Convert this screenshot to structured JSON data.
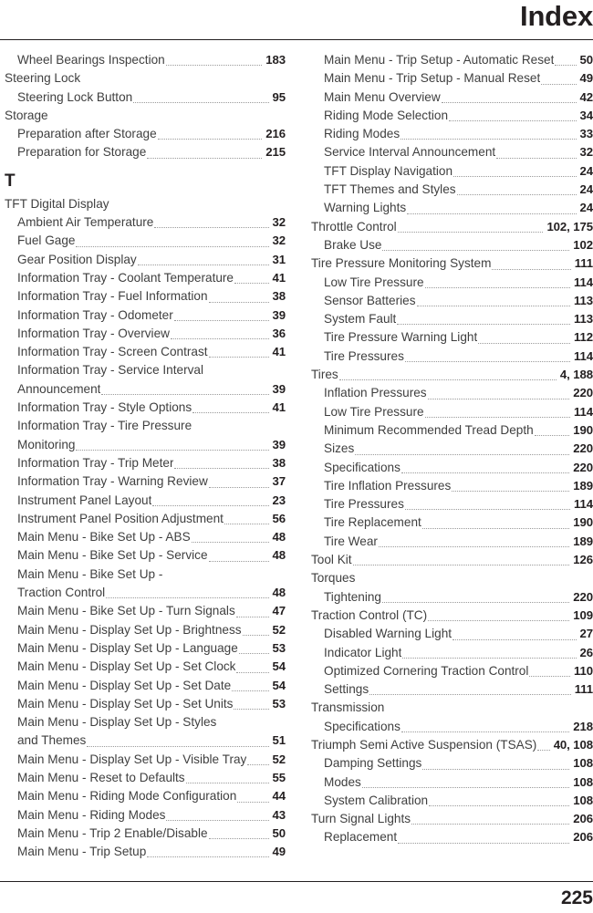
{
  "header": {
    "title": "Index"
  },
  "footer": {
    "page_number": "225"
  },
  "columns": {
    "left": [
      {
        "type": "entry",
        "level": 1,
        "label": "Wheel Bearings Inspection",
        "page": "183"
      },
      {
        "type": "entry",
        "level": 0,
        "label": "Steering Lock",
        "page": ""
      },
      {
        "type": "entry",
        "level": 1,
        "label": "Steering Lock Button",
        "page": "95"
      },
      {
        "type": "entry",
        "level": 0,
        "label": "Storage",
        "page": ""
      },
      {
        "type": "entry",
        "level": 1,
        "label": "Preparation after Storage",
        "page": "216"
      },
      {
        "type": "entry",
        "level": 1,
        "label": "Preparation for Storage",
        "page": "215"
      },
      {
        "type": "letter",
        "label": "T"
      },
      {
        "type": "entry",
        "level": 0,
        "label": "TFT Digital Display",
        "page": ""
      },
      {
        "type": "entry",
        "level": 1,
        "label": "Ambient Air Temperature",
        "page": "32"
      },
      {
        "type": "entry",
        "level": 1,
        "label": "Fuel Gage",
        "page": "32"
      },
      {
        "type": "entry",
        "level": 1,
        "label": "Gear Position Display",
        "page": "31"
      },
      {
        "type": "entry",
        "level": 1,
        "label": "Information Tray - Coolant Temperature",
        "page": "41"
      },
      {
        "type": "entry",
        "level": 1,
        "label": "Information Tray - Fuel Information",
        "page": "38"
      },
      {
        "type": "entry",
        "level": 1,
        "label": "Information Tray - Odometer",
        "page": "39"
      },
      {
        "type": "entry",
        "level": 1,
        "label": "Information Tray - Overview",
        "page": "36"
      },
      {
        "type": "entry",
        "level": 1,
        "label": "Information Tray - Screen Contrast",
        "page": "41"
      },
      {
        "type": "wrap",
        "level": 1,
        "line1": "Information Tray - Service Interval",
        "line2": "Announcement",
        "page": "39"
      },
      {
        "type": "entry",
        "level": 1,
        "label": "Information Tray - Style Options",
        "page": "41"
      },
      {
        "type": "wrap",
        "level": 1,
        "line1": "Information Tray - Tire Pressure",
        "line2": "Monitoring",
        "page": "39"
      },
      {
        "type": "entry",
        "level": 1,
        "label": "Information Tray - Trip Meter",
        "page": "38"
      },
      {
        "type": "entry",
        "level": 1,
        "label": "Information Tray - Warning Review",
        "page": "37"
      },
      {
        "type": "entry",
        "level": 1,
        "label": "Instrument Panel Layout",
        "page": "23"
      },
      {
        "type": "entry",
        "level": 1,
        "label": "Instrument Panel Position Adjustment",
        "page": "56"
      },
      {
        "type": "entry",
        "level": 1,
        "label": "Main Menu - Bike Set Up - ABS",
        "page": "48"
      },
      {
        "type": "entry",
        "level": 1,
        "label": "Main Menu - Bike Set Up - Service",
        "page": "48"
      },
      {
        "type": "wrap",
        "level": 1,
        "line1": "Main Menu - Bike Set Up -",
        "line2": "Traction Control",
        "page": "48"
      },
      {
        "type": "entry",
        "level": 1,
        "label": "Main Menu - Bike Set Up - Turn Signals",
        "page": "47"
      },
      {
        "type": "entry",
        "level": 1,
        "label": "Main Menu - Display Set Up - Brightness",
        "page": "52"
      },
      {
        "type": "entry",
        "level": 1,
        "label": "Main Menu - Display Set Up - Language",
        "page": "53"
      },
      {
        "type": "entry",
        "level": 1,
        "label": "Main Menu - Display Set Up - Set Clock",
        "page": "54"
      },
      {
        "type": "entry",
        "level": 1,
        "label": "Main Menu - Display Set Up - Set Date",
        "page": "54"
      },
      {
        "type": "entry",
        "level": 1,
        "label": "Main Menu - Display Set Up - Set Units",
        "page": "53"
      },
      {
        "type": "wrap",
        "level": 1,
        "line1": "Main Menu - Display Set Up - Styles",
        "line2": "and Themes",
        "page": "51"
      },
      {
        "type": "entry",
        "level": 1,
        "label": "Main Menu - Display Set Up - Visible Tray",
        "page": "52"
      },
      {
        "type": "entry",
        "level": 1,
        "label": "Main Menu - Reset to Defaults",
        "page": "55"
      },
      {
        "type": "entry",
        "level": 1,
        "label": "Main Menu - Riding Mode Configuration",
        "page": "44"
      },
      {
        "type": "entry",
        "level": 1,
        "label": "Main Menu - Riding Modes",
        "page": "43"
      },
      {
        "type": "entry",
        "level": 1,
        "label": "Main Menu - Trip 2 Enable/Disable",
        "page": "50"
      },
      {
        "type": "entry",
        "level": 1,
        "label": "Main Menu - Trip Setup",
        "page": "49"
      }
    ],
    "right": [
      {
        "type": "entry",
        "level": 1,
        "label": "Main Menu - Trip Setup - Automatic Reset",
        "page": "50"
      },
      {
        "type": "entry",
        "level": 1,
        "label": "Main Menu - Trip Setup - Manual Reset",
        "page": "49"
      },
      {
        "type": "entry",
        "level": 1,
        "label": "Main Menu Overview",
        "page": "42"
      },
      {
        "type": "entry",
        "level": 1,
        "label": "Riding Mode Selection",
        "page": "34"
      },
      {
        "type": "entry",
        "level": 1,
        "label": "Riding Modes",
        "page": "33"
      },
      {
        "type": "entry",
        "level": 1,
        "label": "Service Interval Announcement",
        "page": "32"
      },
      {
        "type": "entry",
        "level": 1,
        "label": "TFT Display Navigation",
        "page": "24"
      },
      {
        "type": "entry",
        "level": 1,
        "label": "TFT Themes and Styles",
        "page": "24"
      },
      {
        "type": "entry",
        "level": 1,
        "label": "Warning Lights",
        "page": "24"
      },
      {
        "type": "entry",
        "level": 0,
        "label": "Throttle Control",
        "page": "102, 175"
      },
      {
        "type": "entry",
        "level": 1,
        "label": "Brake Use",
        "page": "102"
      },
      {
        "type": "entry",
        "level": 0,
        "label": "Tire Pressure Monitoring System",
        "page": "111"
      },
      {
        "type": "entry",
        "level": 1,
        "label": "Low Tire Pressure",
        "page": "114"
      },
      {
        "type": "entry",
        "level": 1,
        "label": "Sensor Batteries",
        "page": "113"
      },
      {
        "type": "entry",
        "level": 1,
        "label": "System Fault",
        "page": "113"
      },
      {
        "type": "entry",
        "level": 1,
        "label": "Tire Pressure Warning Light",
        "page": "112"
      },
      {
        "type": "entry",
        "level": 1,
        "label": "Tire Pressures",
        "page": "114"
      },
      {
        "type": "entry",
        "level": 0,
        "label": "Tires",
        "page": "4, 188"
      },
      {
        "type": "entry",
        "level": 1,
        "label": "Inflation Pressures",
        "page": "220"
      },
      {
        "type": "entry",
        "level": 1,
        "label": "Low Tire Pressure",
        "page": "114"
      },
      {
        "type": "entry",
        "level": 1,
        "label": "Minimum Recommended Tread Depth",
        "page": "190"
      },
      {
        "type": "entry",
        "level": 1,
        "label": "Sizes",
        "page": "220"
      },
      {
        "type": "entry",
        "level": 1,
        "label": "Specifications",
        "page": "220"
      },
      {
        "type": "entry",
        "level": 1,
        "label": "Tire Inflation Pressures",
        "page": "189"
      },
      {
        "type": "entry",
        "level": 1,
        "label": "Tire Pressures",
        "page": "114"
      },
      {
        "type": "entry",
        "level": 1,
        "label": "Tire Replacement",
        "page": "190"
      },
      {
        "type": "entry",
        "level": 1,
        "label": "Tire Wear",
        "page": "189"
      },
      {
        "type": "entry",
        "level": 0,
        "label": "Tool Kit",
        "page": "126"
      },
      {
        "type": "entry",
        "level": 0,
        "label": "Torques",
        "page": ""
      },
      {
        "type": "entry",
        "level": 1,
        "label": "Tightening",
        "page": "220"
      },
      {
        "type": "entry",
        "level": 0,
        "label": "Traction Control (TC)",
        "page": "109"
      },
      {
        "type": "entry",
        "level": 1,
        "label": "Disabled Warning Light",
        "page": "27"
      },
      {
        "type": "entry",
        "level": 1,
        "label": "Indicator Light",
        "page": "26"
      },
      {
        "type": "entry",
        "level": 1,
        "label": "Optimized Cornering Traction Control",
        "page": "110"
      },
      {
        "type": "entry",
        "level": 1,
        "label": "Settings",
        "page": "111"
      },
      {
        "type": "entry",
        "level": 0,
        "label": "Transmission",
        "page": ""
      },
      {
        "type": "entry",
        "level": 1,
        "label": "Specifications",
        "page": "218"
      },
      {
        "type": "entry",
        "level": 0,
        "label": "Triumph Semi Active Suspension (TSAS)",
        "page": "40, 108"
      },
      {
        "type": "entry",
        "level": 1,
        "label": "Damping Settings",
        "page": "108"
      },
      {
        "type": "entry",
        "level": 1,
        "label": "Modes",
        "page": "108"
      },
      {
        "type": "entry",
        "level": 1,
        "label": "System Calibration",
        "page": "108"
      },
      {
        "type": "entry",
        "level": 0,
        "label": "Turn Signal Lights",
        "page": "206"
      },
      {
        "type": "entry",
        "level": 1,
        "label": "Replacement",
        "page": "206"
      }
    ]
  }
}
